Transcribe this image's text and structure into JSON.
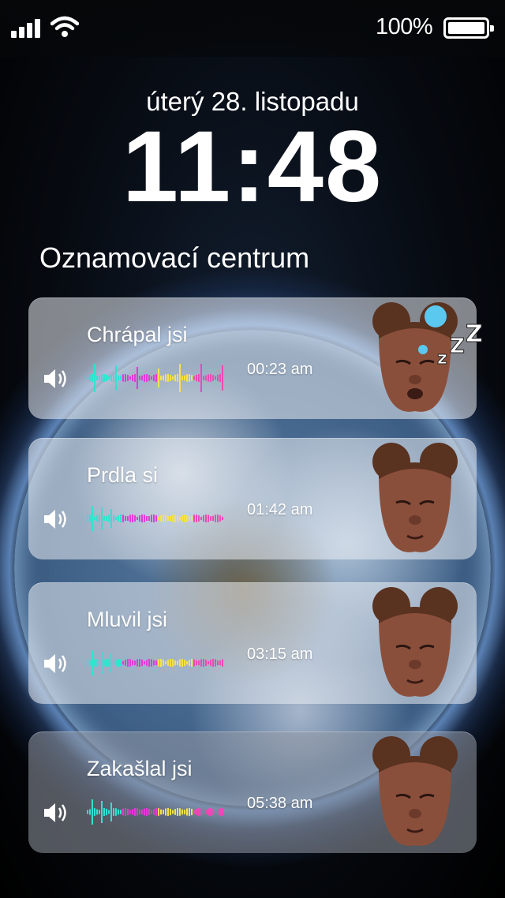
{
  "status_bar": {
    "battery_text": "100%"
  },
  "lock_screen": {
    "date": "úterý 28. listopadu",
    "time": "11:48",
    "section_title": "Oznamovací centrum"
  },
  "notifications": [
    {
      "title": "Chrápal jsi",
      "time": "00:23 am",
      "icon": "speaker-icon",
      "avatar": "sleeping-memoji",
      "extra": "zzz-icon"
    },
    {
      "title": "Prdla si",
      "time": "01:42 am",
      "icon": "speaker-icon",
      "avatar": "memoji"
    },
    {
      "title": "Mluvil jsi",
      "time": "03:15 am",
      "icon": "speaker-icon",
      "avatar": "memoji"
    },
    {
      "title": "Zakašlal jsi",
      "time": "05:38 am",
      "icon": "speaker-icon",
      "avatar": "memoji"
    }
  ],
  "colors": {
    "wave_gradient": [
      "#33e1d2",
      "#e03bd6",
      "#f6e24b",
      "#e84bb8"
    ]
  }
}
